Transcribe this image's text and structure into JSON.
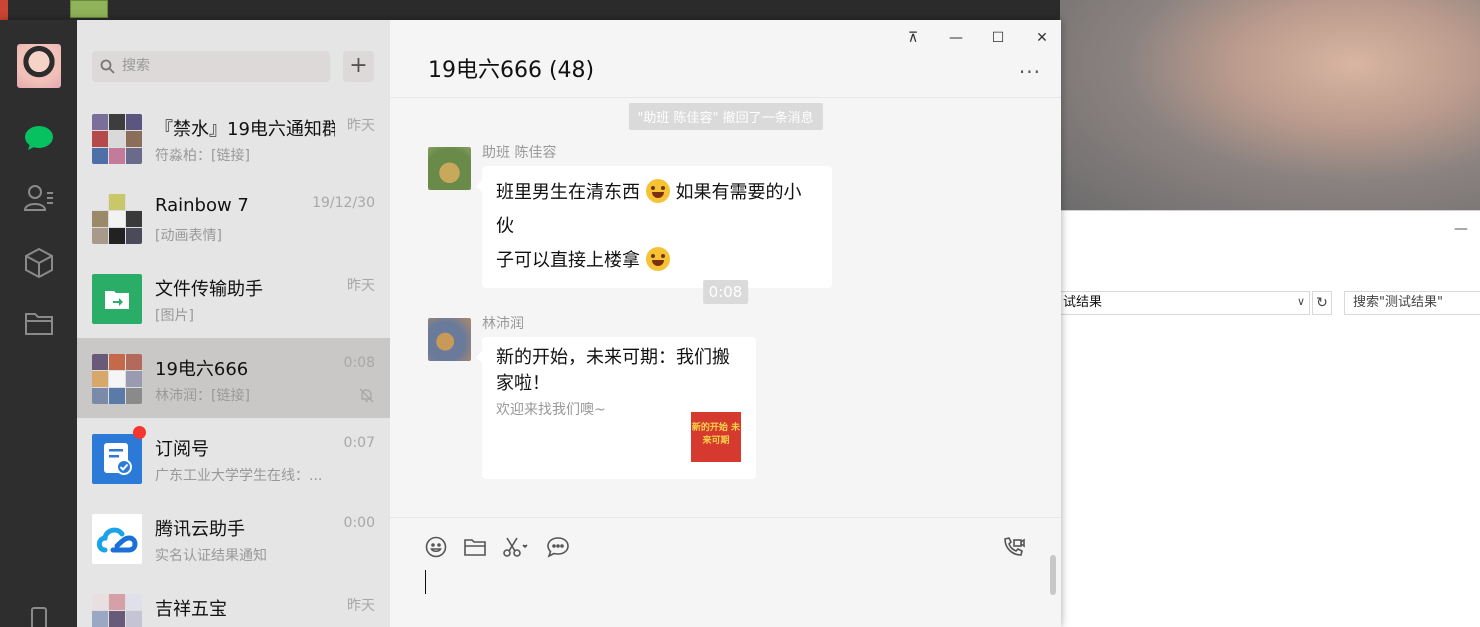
{
  "explorer": {
    "path_text": "试结果",
    "search_placeholder": "搜索\"测试结果\"",
    "min_glyph": "—",
    "dropdown_glyph": "∨",
    "refresh_glyph": "↻"
  },
  "sidebar": {
    "icons": [
      "chat-icon",
      "contacts-icon",
      "favorites-icon",
      "files-icon",
      "phone-icon"
    ]
  },
  "search": {
    "placeholder": "搜索",
    "add_glyph": "+"
  },
  "sessions": [
    {
      "name": "『禁水』19电六通知群",
      "time": "昨天",
      "message": "符淼柏：[链接]"
    },
    {
      "name": "Rainbow 7",
      "time": "19/12/30",
      "message": "[动画表情]"
    },
    {
      "name": "文件传输助手",
      "time": "昨天",
      "message": "[图片]"
    },
    {
      "name": "19电六666",
      "time": "0:08",
      "message": "林沛润：[链接]",
      "muted": true
    },
    {
      "name": "订阅号",
      "time": "0:07",
      "message": "广东工业大学学生在线：...",
      "unread": true
    },
    {
      "name": "腾讯云助手",
      "time": "0:00",
      "message": "实名认证结果通知"
    },
    {
      "name": "吉祥五宝",
      "time": "昨天",
      "message": ""
    }
  ],
  "chat": {
    "title": "19电六666 (48)",
    "more_glyph": "···",
    "window_buttons": {
      "pin": "⊼",
      "minimize": "—",
      "maximize": "☐",
      "close": "✕"
    },
    "recall_notice": "\"助班 陈佳容\" 撤回了一条消息",
    "messages": [
      {
        "sender": "助班 陈佳容",
        "text_line1_a": "班里男生在清东西",
        "text_line1_b": "如果有需要的小伙",
        "text_line2": "子可以直接上楼拿"
      },
      {
        "time": "0:08"
      },
      {
        "sender": "林沛润",
        "card_title": "新的开始，未来可期：我们搬家啦！",
        "card_desc": "欢迎来找我们噢~",
        "thumb_text": "新的开始 未来可期"
      }
    ]
  },
  "toolbar": [
    "emoji-icon",
    "folder-icon",
    "scissors-icon",
    "chat-bubble-icon",
    "video-call-icon"
  ],
  "colors": {
    "sidebar_bg": "#2e2e2e",
    "session_bg": "#e6e5e5",
    "active_session_bg": "#c9c8c7",
    "chat_bg": "#f5f5f5",
    "wechat_green": "#07c160",
    "unread_red": "#f43530"
  }
}
